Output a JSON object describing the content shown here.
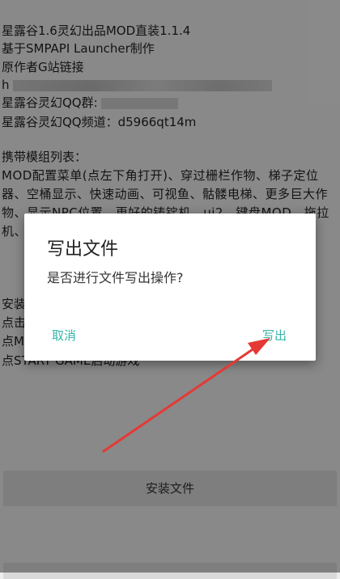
{
  "info": {
    "line1": "星露谷1.6灵幻出品MOD直装1.1.4",
    "line2": "基于SMPAPI Launcher制作",
    "line3": "原作者G站链接",
    "line4_prefix": "h",
    "line5": "星露谷灵幻QQ群:",
    "line6": "星露谷灵幻QQ频道：d5966qt14m"
  },
  "mods": {
    "heading": "携带模组列表：",
    "description": "MOD配置菜单(点左下角打开)、穿过栅栏作物、梯子定位器、空桶显示、快速动画、可视鱼、骷髅电梯、更多巨大作物、显示NPC位置、更好的铸锭机、ui2、键盘MOD、拖拉机、"
  },
  "install": {
    "line1": "安装",
    "line2": "点击",
    "line3": "点M",
    "line4": "点START GAME启动游戏"
  },
  "buttons": {
    "install_file": "安装文件"
  },
  "dialog": {
    "title": "写出文件",
    "message": "是否进行文件写出操作?",
    "cancel": "取消",
    "confirm": "写出"
  },
  "colors": {
    "dialog_button": "#35b5a8",
    "annotation_arrow": "#e53935"
  }
}
